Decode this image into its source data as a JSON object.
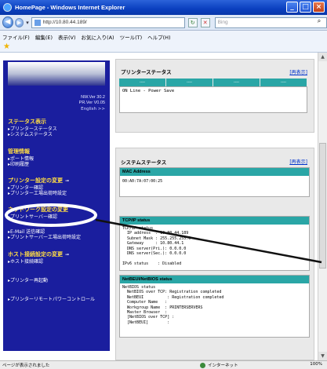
{
  "window": {
    "title": "HomePage - Windows Internet Explorer",
    "controls": {
      "minimize": "_",
      "maximize": "□",
      "close": "×"
    }
  },
  "address": {
    "url": "http://10.80.44.189/",
    "search_placeholder": "Bing"
  },
  "menu": {
    "items": [
      "ファイル(F)",
      "編集(E)",
      "表示(V)",
      "お気に入り(A)",
      "ツール(T)",
      "ヘルプ(H)"
    ]
  },
  "sidebar": {
    "nw_version": "NW.Ver 30.2",
    "pr_version": "PR.Ver V0.05",
    "english_link": "English >>",
    "sections": [
      {
        "title": "ステータス表示",
        "items": [
          "▸プリンターステータス",
          "▸システムステータス"
        ]
      },
      {
        "title": "管理情報",
        "items": [
          "▸ポート情報",
          "▸印刷履歴"
        ]
      },
      {
        "title": "プリンター設定の変更",
        "items": [
          "▸プリンター確認",
          "▸プリンター工場出荷時設定"
        ]
      },
      {
        "title": "ネットワーク設定の変更",
        "items": [
          "▸プリントサーバー確認",
          "▸E-Mail 送信確認",
          "▸プリントサーバー工場出荷時設定"
        ]
      },
      {
        "title": "ホスト接続設定の変更",
        "items": [
          "▸ホスト接続確認"
        ]
      },
      {
        "title": "",
        "items": [
          "▸プリンター再起動"
        ]
      },
      {
        "title": "",
        "items": [
          "▸プリンターリモートパワーコントロール"
        ]
      }
    ]
  },
  "printer_status": {
    "title": "プリンターステータス",
    "hide_label": "[再表示]",
    "header_cells": [
      "----",
      "----",
      "----",
      "----"
    ],
    "message": "ON Line - Power Save"
  },
  "system_status": {
    "title": "システムステータス",
    "hide_label": "[再表示]",
    "mac": {
      "header": "MAC Address",
      "value": "00:A0:7A:07:00:25"
    },
    "tcpip": {
      "header": "TCP/IP status",
      "lines": [
        "TCP/IP status",
        "  IP address  : 10.80.44.189",
        "  Subnet Mask : 255.255.255.0",
        "  Gateway     : 10.80.44.1",
        "  DNS server(Pri.): 0.0.0.0",
        "  DNS server(Sec.): 0.0.0.0",
        "",
        "IPv6 status    : Disabled"
      ]
    },
    "netbeui": {
      "header": "NetBEUI/NetBIOS status",
      "lines": [
        "NetBIOS status",
        "  NetBIOS over TCP: Registration completed",
        "  NetBEUI          : Registration completed",
        "  Computer Name   :",
        "  Workgroup Name  : PRINTERSERVERS",
        "  Master Browser  :",
        "  [NetBIOS over TCP] :",
        "  [NetBEUI]        :"
      ]
    }
  },
  "statusbar": {
    "left": "ページが表示されました",
    "zone": "インターネット",
    "zoom": "100%"
  }
}
